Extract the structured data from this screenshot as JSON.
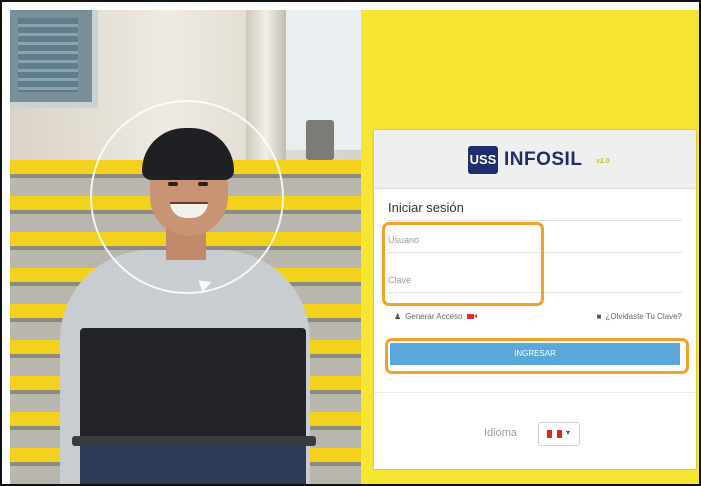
{
  "brand": {
    "badge": "USS",
    "name": "INFOSIL",
    "version": "v2.0"
  },
  "login": {
    "title": "Iniciar sesión",
    "user_placeholder": "Usuario",
    "password_placeholder": "Clave",
    "generate_access_label": "Generar Acceso",
    "forgot_label": "¿Olvidaste Tu Clave?",
    "submit_label": "INGRESAR"
  },
  "language": {
    "label": "Idioma",
    "selected": "Peru flag"
  },
  "icons": {
    "user": "user-icon",
    "lock": "lock-icon",
    "video": "video-camera-icon",
    "caret": "chevron-down-icon"
  },
  "colors": {
    "background_yellow": "#f7e534",
    "brand_navy": "#1e2d6b",
    "button_blue": "#5aa7d9",
    "highlight_orange": "#f2a02a"
  }
}
